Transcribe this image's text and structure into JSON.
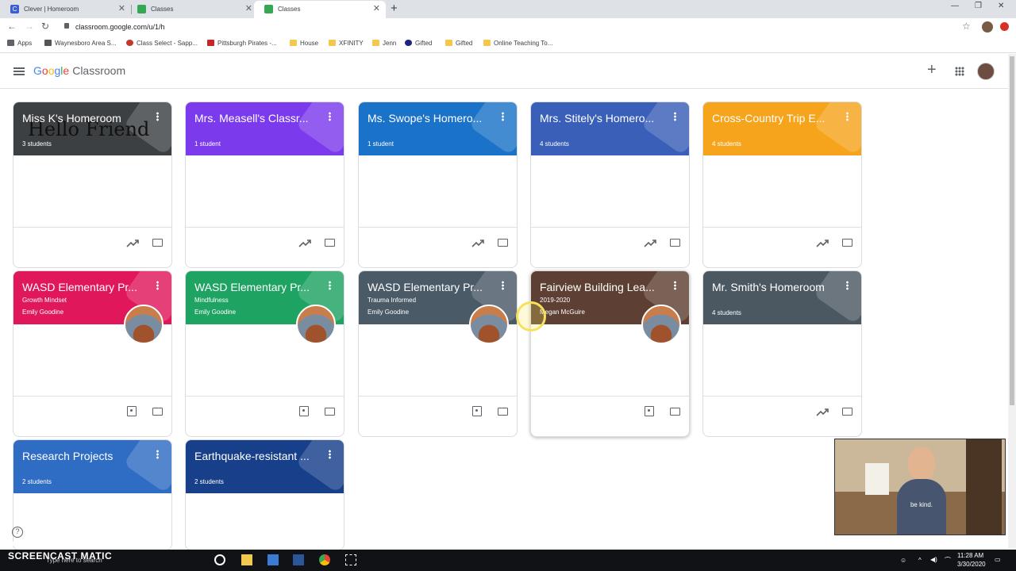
{
  "browser": {
    "tabs": [
      {
        "title": "Clever | Homeroom",
        "fav_color": "#3c5ed1",
        "fav_letter": "C"
      },
      {
        "title": "Classes",
        "fav_color": "#34a853",
        "fav_letter": ""
      },
      {
        "title": "Classes",
        "fav_color": "#34a853",
        "fav_letter": ""
      }
    ],
    "url": "classroom.google.com/u/1/h",
    "bookmarks": [
      "Apps",
      "Waynesboro Area S...",
      "Class Select - Sapp...",
      "Pittsburgh Pirates -...",
      "House",
      "XFINITY",
      "Jenn",
      "Gifted",
      "Gifted",
      "Online Teaching To..."
    ]
  },
  "app": {
    "logo_g": [
      "G",
      "o",
      "o",
      "g",
      "l",
      "e"
    ],
    "logo_name": "Classroom"
  },
  "classes": [
    {
      "name": "Miss K's Homeroom",
      "count": "3 students",
      "color": "#3c4043",
      "art": "Hello Friend",
      "footer": "trend"
    },
    {
      "name": "Mrs. Measell's Classr...",
      "count": "1 student",
      "color": "#7c3aed",
      "footer": "trend"
    },
    {
      "name": "Ms. Swope's Homero...",
      "count": "1 student",
      "color": "#1a73c8",
      "footer": "trend"
    },
    {
      "name": "Mrs. Stitely's Homero...",
      "count": "4 students",
      "color": "#3a5fb8",
      "footer": "trend"
    },
    {
      "name": "Cross-Country Trip E...",
      "count": "4 students",
      "color": "#f6a41b",
      "footer": "trend"
    },
    {
      "name": "WASD Elementary Pr...",
      "section": "Growth Mindset",
      "teacher": "Emily Goodine",
      "color": "#e0175a",
      "footer": "work"
    },
    {
      "name": "WASD Elementary Pr...",
      "section": "Mindfulness",
      "teacher": "Emily Goodine",
      "color": "#1ea362",
      "footer": "work"
    },
    {
      "name": "WASD Elementary Pr...",
      "section": "Trauma Informed",
      "teacher": "Emily Goodine",
      "color": "#4a5a67",
      "footer": "work"
    },
    {
      "name": "Fairview Building Lea...",
      "section": "2019-2020",
      "teacher": "Megan McGuire",
      "color": "#5d4033",
      "footer": "work"
    },
    {
      "name": "Mr. Smith's Homeroom",
      "count": "4 students",
      "color": "#4b5862",
      "footer": "trend"
    },
    {
      "name": "Research Projects",
      "count": "2 students",
      "color": "#2f6cc4",
      "footer": "none"
    },
    {
      "name": "Earthquake-resistant ...",
      "count": "2 students",
      "color": "#173f8a",
      "footer": "none"
    }
  ],
  "presenter": {
    "shirt_text": "be kind."
  },
  "recording": {
    "small": "RECORDED WITH",
    "big": "SCREENCAST MATIC"
  },
  "taskbar": {
    "search_placeholder": "Type here to search",
    "time": "11:28 AM",
    "date": "3/30/2020"
  },
  "help_label": "?"
}
